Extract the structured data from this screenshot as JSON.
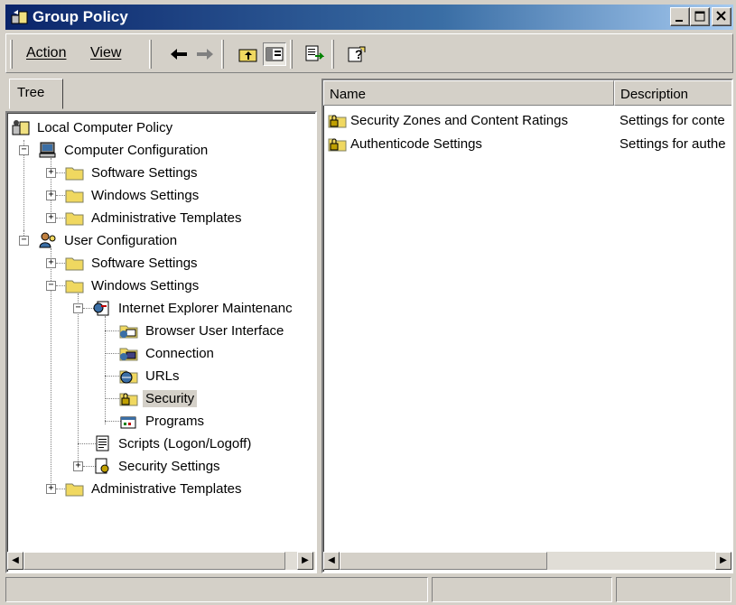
{
  "window": {
    "title": "Group Policy"
  },
  "menu": {
    "action": "Action",
    "view": "View"
  },
  "tabs": {
    "tree": "Tree"
  },
  "tree": [
    {
      "label": "Local Computer Policy",
      "icon": "policy-icon"
    },
    {
      "label": "Computer Configuration",
      "icon": "computer-icon"
    },
    {
      "label": "Software Settings",
      "icon": "folder-icon"
    },
    {
      "label": "Windows Settings",
      "icon": "folder-icon"
    },
    {
      "label": "Administrative Templates",
      "icon": "folder-icon"
    },
    {
      "label": "User Configuration",
      "icon": "user-icon"
    },
    {
      "label": "Software Settings",
      "icon": "folder-icon"
    },
    {
      "label": "Windows Settings",
      "icon": "folder-icon"
    },
    {
      "label": "Internet Explorer Maintenanc",
      "icon": "ie-maintenance-icon"
    },
    {
      "label": "Browser User Interface",
      "icon": "browser-ui-icon"
    },
    {
      "label": "Connection",
      "icon": "connection-icon"
    },
    {
      "label": "URLs",
      "icon": "urls-icon"
    },
    {
      "label": "Security",
      "icon": "security-icon",
      "selected": true
    },
    {
      "label": "Programs",
      "icon": "programs-icon"
    },
    {
      "label": "Scripts (Logon/Logoff)",
      "icon": "scripts-icon"
    },
    {
      "label": "Security Settings",
      "icon": "security-settings-icon"
    },
    {
      "label": "Administrative Templates",
      "icon": "folder-icon"
    }
  ],
  "list": {
    "columns": [
      "Name",
      "Description"
    ],
    "rows": [
      {
        "name": "Security Zones and Content Ratings",
        "description": "Settings for conte"
      },
      {
        "name": "Authenticode Settings",
        "description": "Settings for authe"
      }
    ]
  },
  "colors": {
    "title_start": "#0a246a",
    "title_end": "#a6caf0",
    "face": "#d4d0c8",
    "folder": "#f0d860"
  }
}
